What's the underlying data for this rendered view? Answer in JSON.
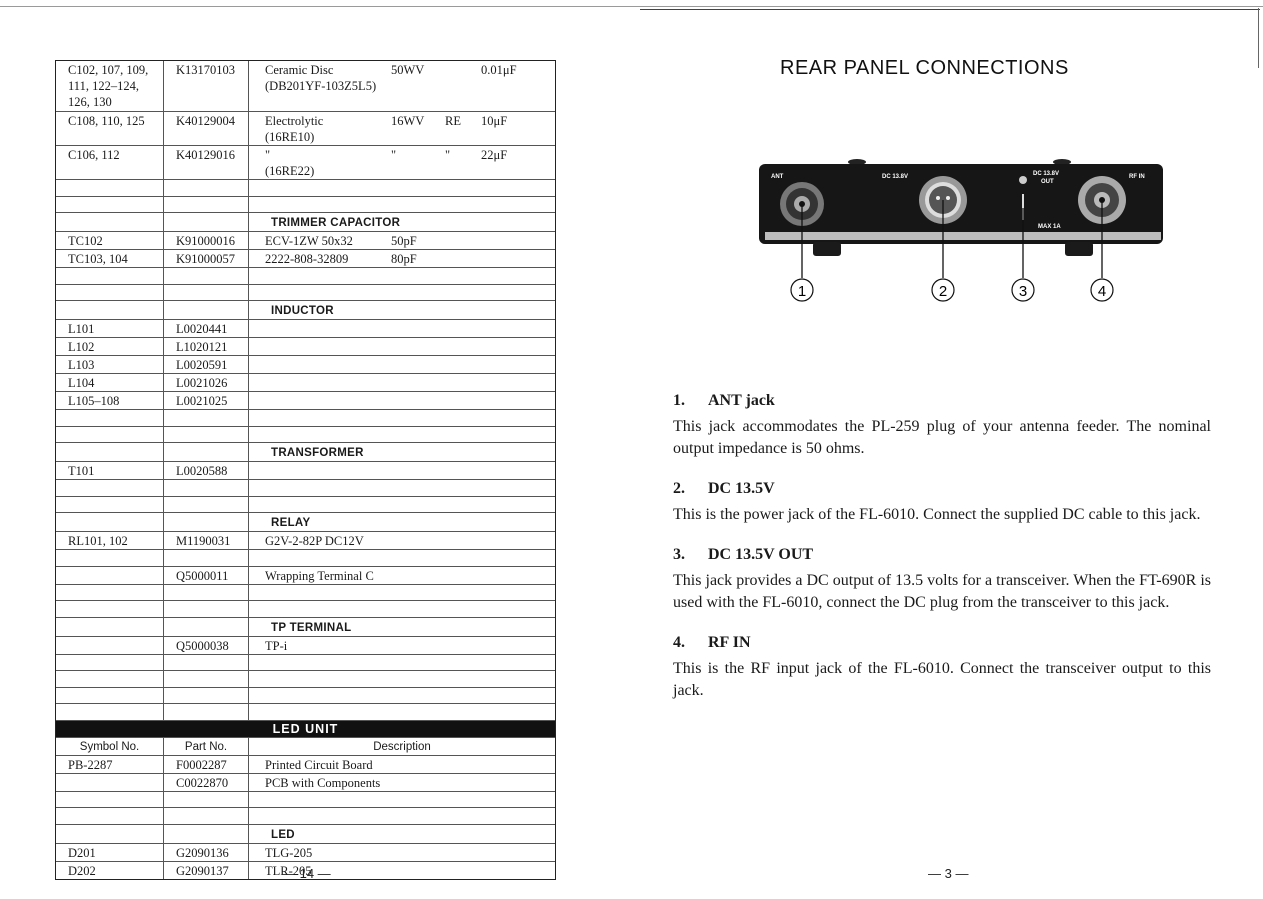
{
  "left_page": {
    "rows": [
      {
        "symbol": "C102, 107, 109,\n111, 122–124,\n126, 130",
        "part": "K13170103",
        "desc": "Ceramic Disc",
        "desc2": "(DB201YF-103Z5L5)",
        "rating": "50WV",
        "type": "",
        "value": "0.01μF",
        "kind": "tall3"
      },
      {
        "symbol": "C108, 110, 125",
        "part": "K40129004",
        "desc": "Electrolytic",
        "desc2": "(16RE10)",
        "rating": "16WV",
        "type": "RE",
        "value": "10μF",
        "kind": "tall2"
      },
      {
        "symbol": "C106, 112",
        "part": "K40129016",
        "desc": "  \"",
        "desc2": "(16RE22)",
        "rating": "\"",
        "type": "\"",
        "value": "22μF",
        "kind": "tall2"
      },
      {
        "kind": "blank"
      },
      {
        "kind": "blank"
      },
      {
        "kind": "section",
        "title": "TRIMMER CAPACITOR"
      },
      {
        "symbol": "TC102",
        "part": "K91000016",
        "desc": "ECV-1ZW 50x32",
        "rating": "50pF"
      },
      {
        "symbol": "TC103, 104",
        "part": "K91000057",
        "desc": "2222-808-32809",
        "rating": "80pF"
      },
      {
        "kind": "blank"
      },
      {
        "kind": "blank"
      },
      {
        "kind": "section",
        "title": "INDUCTOR"
      },
      {
        "symbol": "L101",
        "part": "L0020441",
        "desc": ""
      },
      {
        "symbol": "L102",
        "part": "L1020121",
        "desc": ""
      },
      {
        "symbol": "L103",
        "part": "L0020591",
        "desc": ""
      },
      {
        "symbol": "L104",
        "part": "L0021026",
        "desc": ""
      },
      {
        "symbol": "L105–108",
        "part": "L0021025",
        "desc": ""
      },
      {
        "kind": "blank"
      },
      {
        "kind": "blank"
      },
      {
        "kind": "section",
        "title": "TRANSFORMER"
      },
      {
        "symbol": "T101",
        "part": "L0020588",
        "desc": ""
      },
      {
        "kind": "blank"
      },
      {
        "kind": "blank"
      },
      {
        "kind": "section",
        "title": "RELAY"
      },
      {
        "symbol": "RL101, 102",
        "part": "M1190031",
        "desc": "G2V-2-82P DC12V"
      },
      {
        "kind": "blank"
      },
      {
        "symbol": "",
        "part": "Q5000011",
        "desc": "Wrapping Terminal C"
      },
      {
        "kind": "blank"
      },
      {
        "kind": "blank"
      },
      {
        "kind": "section",
        "title": "TP TERMINAL"
      },
      {
        "symbol": "",
        "part": "Q5000038",
        "desc": "TP-i"
      },
      {
        "kind": "blank"
      },
      {
        "kind": "blank"
      },
      {
        "kind": "blank"
      },
      {
        "kind": "blank"
      }
    ],
    "led_unit": {
      "title": "LED  UNIT",
      "headers": {
        "symbol": "Symbol No.",
        "part": "Part No.",
        "desc": "Description"
      },
      "rows": [
        {
          "symbol": "PB-2287",
          "part": "F0002287",
          "desc": "Printed Circuit Board"
        },
        {
          "symbol": "",
          "part": "C0022870",
          "desc": "PCB with Components"
        },
        {
          "kind": "blank"
        },
        {
          "kind": "blank"
        },
        {
          "kind": "section",
          "title": "LED"
        },
        {
          "symbol": "D201",
          "part": "G2090136",
          "desc": "TLG-205"
        },
        {
          "symbol": "D202",
          "part": "G2090137",
          "desc": "TLR-205"
        }
      ]
    },
    "page_number": "— 14 —"
  },
  "right_page": {
    "title": "REAR PANEL CONNECTIONS",
    "figure": {
      "labels": [
        "ANT",
        "DC 13.8V",
        "DC 13.8V",
        "OUT",
        "MAX 1A",
        "RF IN"
      ],
      "callouts": [
        "1",
        "2",
        "3",
        "4"
      ]
    },
    "sections": [
      {
        "num": "1.",
        "title": "ANT jack",
        "body": "This jack accommodates the PL-259 plug of your antenna feeder. The nominal output impedance is 50 ohms."
      },
      {
        "num": "2.",
        "title": "DC 13.5V",
        "body": "This is the power jack of the FL-6010. Connect the supplied DC cable to this jack."
      },
      {
        "num": "3.",
        "title": "DC 13.5V OUT",
        "body": "This jack provides a DC output of 13.5 volts for a transceiver. When the FT-690R is used with the FL-6010, connect the DC plug from the transceiver to this jack."
      },
      {
        "num": "4.",
        "title": "RF IN",
        "body": "This is the RF input jack of the FL-6010. Connect the transceiver output to this jack."
      }
    ],
    "page_number": "— 3 —"
  }
}
